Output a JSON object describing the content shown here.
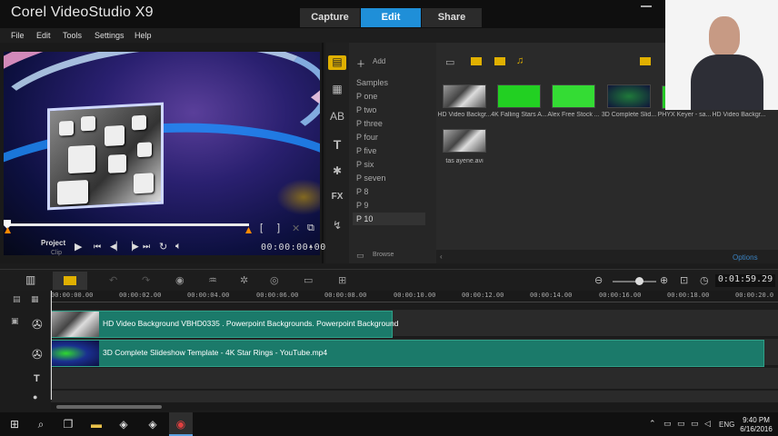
{
  "app": {
    "title": "Corel VideoStudio X9"
  },
  "nav_tabs": [
    {
      "label": "Capture",
      "active": false
    },
    {
      "label": "Edit",
      "active": true
    },
    {
      "label": "Share",
      "active": false
    }
  ],
  "menu": [
    "File",
    "Edit",
    "Tools",
    "Settings",
    "Help"
  ],
  "preview": {
    "mode_project": "Project",
    "mode_clip": "Clip",
    "timecode": "00:00:00:00"
  },
  "library": {
    "add_label": "Add",
    "folders": [
      "Samples",
      "P one",
      "P two",
      "P three",
      "P four",
      "P five",
      "P six",
      "P seven",
      "P 8",
      "P 9",
      "P 10"
    ],
    "selected_folder": "P 10",
    "browse_label": "Browse",
    "options_label": "Options",
    "items": [
      {
        "label": "HD Video Backgr..."
      },
      {
        "label": "4K Falling Stars A..."
      },
      {
        "label": "Alex Free Stock ..."
      },
      {
        "label": "3D Complete Slid..."
      },
      {
        "label": "PHYX Keyer - sa..."
      },
      {
        "label": "HD Video Backgr..."
      },
      {
        "label": "tas ayene.avi"
      }
    ]
  },
  "timeline": {
    "project_timecode": "0:01:59.29",
    "ruler": [
      "00:00:00.00",
      "00:00:02.00",
      "00:00:04.00",
      "00:00:06.00",
      "00:00:08.00",
      "00:00:10.00",
      "00:00:12.00",
      "00:00:14.00",
      "00:00:16.00",
      "00:00:18.00",
      "00:00:20.0"
    ],
    "clips": [
      {
        "label": "HD Video Background VBHD0335 . Powerpoint Backgrounds. Powerpoint Background"
      },
      {
        "label": "3D Complete Slideshow Template - 4K Star Rings - YouTube.mp4"
      }
    ]
  },
  "taskbar": {
    "lang": "ENG",
    "time": "9:40 PM",
    "date": "6/16/2016"
  },
  "colors": {
    "accent": "#1f8fd8",
    "clip": "#1b7a6a",
    "trim": "#ff8a00"
  }
}
